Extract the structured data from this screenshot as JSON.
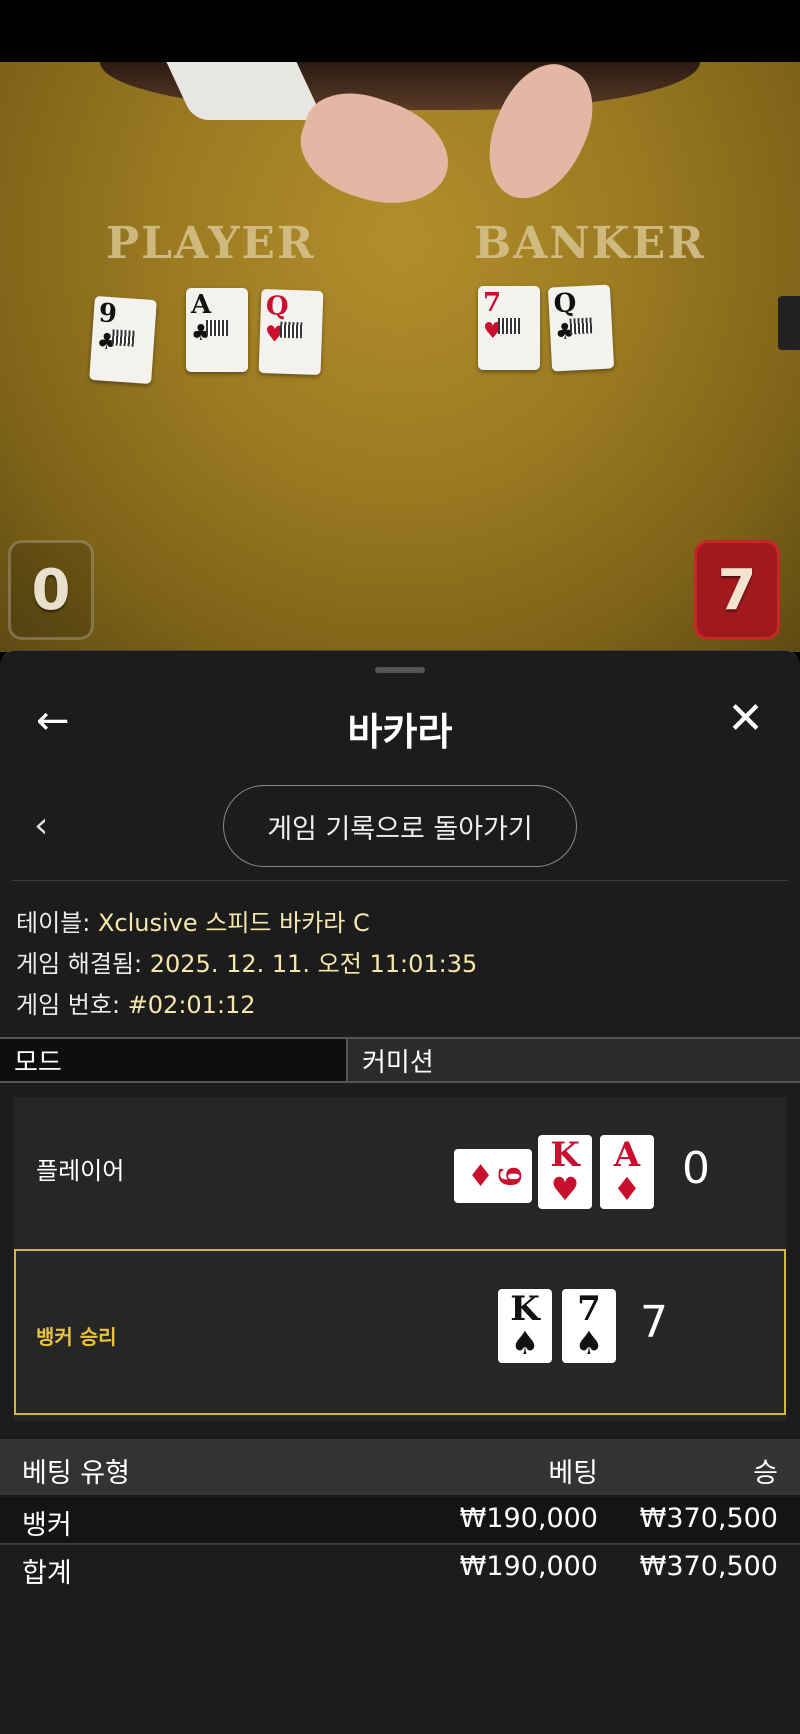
{
  "video": {
    "player_label": "PLAYER",
    "banker_label": "BANKER",
    "player_score": "0",
    "banker_score": "7",
    "player_cards": [
      {
        "rank": "9",
        "suit": "♣"
      },
      {
        "rank": "A",
        "suit": "♣"
      },
      {
        "rank": "Q",
        "suit": "♥"
      }
    ],
    "banker_cards": [
      {
        "rank": "7",
        "suit": "♥"
      },
      {
        "rank": "Q",
        "suit": "♣"
      }
    ]
  },
  "header": {
    "back_icon": "←",
    "title": "바카라",
    "close_icon": "✕"
  },
  "nav": {
    "prev_icon": "‹",
    "back_to_history": "게임 기록으로 돌아가기"
  },
  "info": {
    "table_label": "테이블: ",
    "table_value": "Xclusive 스피드 바카라 C",
    "resolved_label": "게임 해결됨: ",
    "resolved_value": "2025. 12. 11. 오전 11:01:35",
    "number_label": "게임 번호: ",
    "number_value": "#02:01:12"
  },
  "tabs": {
    "mode": "모드",
    "commission": "커미션"
  },
  "result": {
    "player_label": "플레이어",
    "player_total": "0",
    "player_cards": [
      {
        "rank": "9",
        "suit": "♦",
        "sideways": true
      },
      {
        "rank": "K",
        "suit": "♥"
      },
      {
        "rank": "A",
        "suit": "♦"
      }
    ],
    "banker_label": "뱅커 승리",
    "banker_total": "7",
    "banker_cards": [
      {
        "rank": "K",
        "suit": "♠"
      },
      {
        "rank": "7",
        "suit": "♠"
      }
    ]
  },
  "bets": {
    "headers": {
      "type": "베팅 유형",
      "bet": "베팅",
      "win": "승"
    },
    "rows": [
      {
        "type": "뱅커",
        "bet": "₩190,000",
        "win": "₩370,500"
      }
    ],
    "total": {
      "type": "합계",
      "bet": "₩190,000",
      "win": "₩370,500"
    }
  },
  "colors": {
    "accent_yellow": "#d4b93a",
    "value_text": "#f6e7a8",
    "banker_score_bg": "#a1191c",
    "sheet_bg": "#1c1c1c"
  }
}
